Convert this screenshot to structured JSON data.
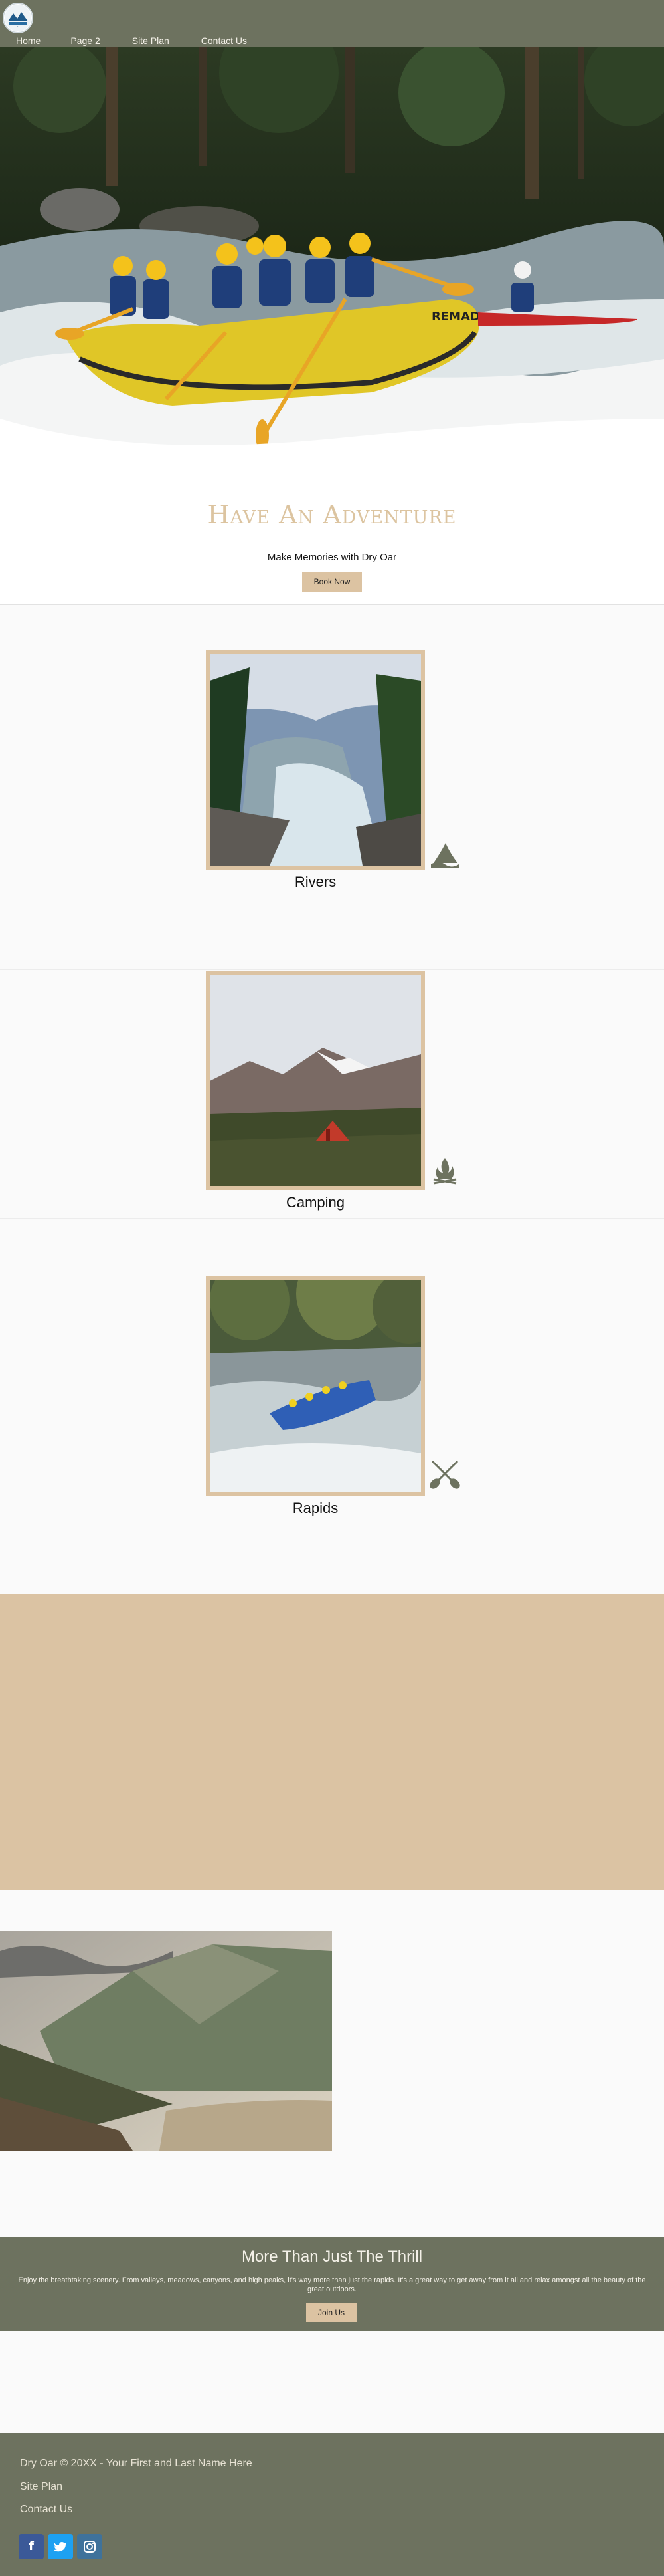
{
  "header": {
    "nav": [
      "Home",
      "Page 2",
      "Site Plan",
      "Contact Us"
    ]
  },
  "hero": {
    "title": "Have An Adventure",
    "subtitle": "Make Memories with Dry Oar",
    "button": "Book Now",
    "raft_text": "REMAD"
  },
  "features": [
    {
      "label": "Rivers",
      "icon": "wave-hat-icon"
    },
    {
      "label": "Camping",
      "icon": "campfire-icon"
    },
    {
      "label": "Rapids",
      "icon": "crossed-paddles-icon"
    }
  ],
  "thrill": {
    "title": "More Than Just The Thrill",
    "text": "Enjoy the breathtaking scenery. From valleys, meadows, canyons, and high peaks, it's way more than just the rapids. It's a great way to get away from it all and relax amongst all the beauty of the great outdoors.",
    "button": "Join Us"
  },
  "footer": {
    "copyright": "Dry Oar © 20XX - Your First and Last Name Here",
    "links": [
      "Site Plan",
      "Contact Us"
    ],
    "social": [
      "facebook-icon",
      "twitter-icon",
      "instagram-icon"
    ]
  },
  "colors": {
    "olive": "#6d725f",
    "tan": "#dbc3a3",
    "title_tan": "#dcc4a0"
  }
}
